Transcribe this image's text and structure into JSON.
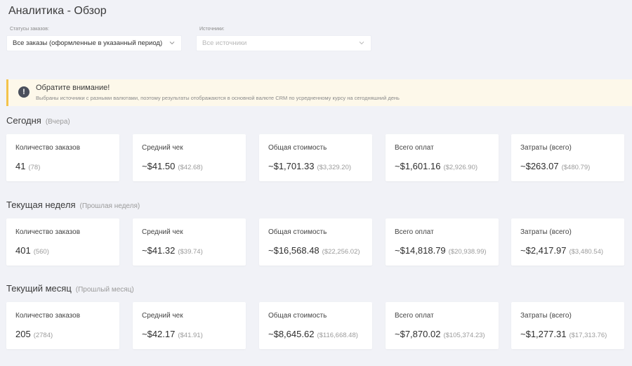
{
  "header": {
    "title": "Аналитика - Обзор"
  },
  "filters": {
    "status": {
      "label": "Статусы заказов:",
      "value": "Все заказы (оформленные в указанный период)"
    },
    "sources": {
      "label": "Источники:",
      "placeholder": "Все источники"
    }
  },
  "notice": {
    "title": "Обратите внимание!",
    "text": "Выбраны источники с разными валютами, поэтому результаты отображаются в основной валюте CRM по усредненному курсу на сегодняшний день",
    "accent_color": "#f3c34a",
    "icon": "exclamation-circle-icon"
  },
  "sections": [
    {
      "title": "Сегодня",
      "prev_label": "(Вчера)",
      "cards": [
        {
          "label": "Количество заказов",
          "value": "41",
          "prev": "(78)"
        },
        {
          "label": "Средний чек",
          "value": "~$41.50",
          "prev": "($42.68)"
        },
        {
          "label": "Общая стоимость",
          "value": "~$1,701.33",
          "prev": "($3,329.20)"
        },
        {
          "label": "Всего оплат",
          "value": "~$1,601.16",
          "prev": "($2,926.90)"
        },
        {
          "label": "Затраты (всего)",
          "value": "~$263.07",
          "prev": "($480.79)"
        }
      ]
    },
    {
      "title": "Текущая неделя",
      "prev_label": "(Прошлая неделя)",
      "cards": [
        {
          "label": "Количество заказов",
          "value": "401",
          "prev": "(560)"
        },
        {
          "label": "Средний чек",
          "value": "~$41.32",
          "prev": "($39.74)"
        },
        {
          "label": "Общая стоимость",
          "value": "~$16,568.48",
          "prev": "($22,256.02)"
        },
        {
          "label": "Всего оплат",
          "value": "~$14,818.79",
          "prev": "($20,938.99)"
        },
        {
          "label": "Затраты (всего)",
          "value": "~$2,417.97",
          "prev": "($3,480.54)"
        }
      ]
    },
    {
      "title": "Текущий месяц",
      "prev_label": "(Прошлый месяц)",
      "cards": [
        {
          "label": "Количество заказов",
          "value": "205",
          "prev": "(2784)"
        },
        {
          "label": "Средний чек",
          "value": "~$42.17",
          "prev": "($41.91)"
        },
        {
          "label": "Общая стоимость",
          "value": "~$8,645.62",
          "prev": "($116,668.48)"
        },
        {
          "label": "Всего оплат",
          "value": "~$7,870.02",
          "prev": "($105,374.23)"
        },
        {
          "label": "Затраты (всего)",
          "value": "~$1,277.31",
          "prev": "($17,313.76)"
        }
      ]
    }
  ]
}
